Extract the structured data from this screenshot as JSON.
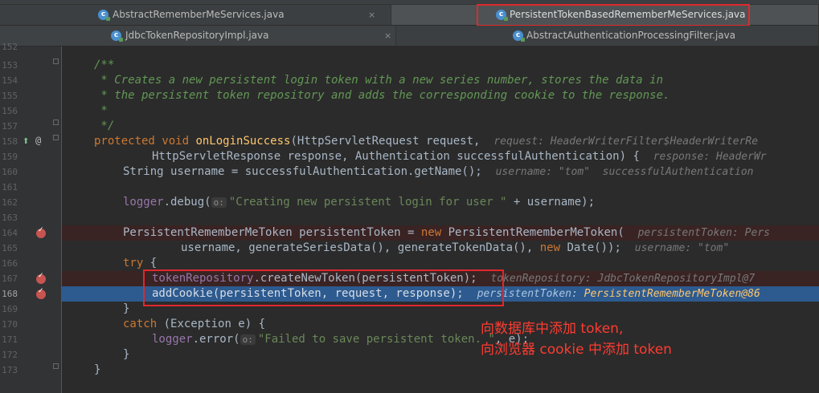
{
  "tabs_row1": [
    {
      "label": "AbstractRememberMeServices.java",
      "close": "×",
      "active": false
    },
    {
      "label": "PersistentTokenBasedRememberMeServices.java",
      "active": true
    }
  ],
  "tabs_row2": [
    {
      "label": "JdbcTokenRepositoryImpl.java",
      "close": "×"
    },
    {
      "label": "AbstractAuthenticationProcessingFilter.java"
    }
  ],
  "line_numbers": [
    "152",
    "153",
    "154",
    "155",
    "156",
    "157",
    "158",
    "159",
    "160",
    "161",
    "162",
    "163",
    "164",
    "165",
    "166",
    "167",
    "168",
    "169",
    "170",
    "171",
    "172",
    "173"
  ],
  "code": {
    "l153": "/**",
    "l154": " * Creates a new persistent login token with a new series number, stores the data in",
    "l155": " * the persistent token repository and adds the corresponding cookie to the response.",
    "l156": " *",
    "l157": " */",
    "l158_kw1": "protected",
    "l158_kw2": "void",
    "l158_fn": "onLoginSuccess",
    "l158_rest": "(HttpServletRequest request,",
    "l158_hint": "request: HeaderWriterFilter$HeaderWriterRe",
    "l159": "HttpServletResponse response, Authentication successfulAuthentication) {",
    "l159_hint": "response: HeaderWr",
    "l160": "String username = successfulAuthentication.getName();",
    "l160_hint": "username: \"tom\"  successfulAuthentication",
    "l162_fld": "logger",
    "l162_a": ".debug(",
    "l162_o": "o:",
    "l162_str": "\"Creating new persistent login for user \"",
    "l162_b": " + username);",
    "l164_a": "PersistentRememberMeToken persistentToken = ",
    "l164_kw": "new",
    "l164_b": " PersistentRememberMeToken(",
    "l164_hint": "persistentToken: Pers",
    "l165_a": "username, generateSeriesData(), generateTokenData(), ",
    "l165_kw": "new",
    "l165_b": " Date());",
    "l165_hint": "username: \"tom\"",
    "l166_kw": "try",
    "l166_b": " {",
    "l167_fld": "tokenRepository",
    "l167_b": ".createNewToken(persistentToken);",
    "l167_hint": "tokenRepository: JdbcTokenRepositoryImpl@7",
    "l168": "addCookie(persistentToken, request, response);",
    "l168_hint_k": "persistentToken: ",
    "l168_hint_v": "PersistentRememberMeToken@86",
    "l169": "}",
    "l170_kw": "catch",
    "l170_b": " (Exception e) {",
    "l171_fld": "logger",
    "l171_a": ".error(",
    "l171_o": "o:",
    "l171_str": "\"Failed to save persistent token. \"",
    "l171_b": ", e);",
    "l172": "}",
    "l173": "}"
  },
  "gutter_marks": {
    "implements": "⬆",
    "override": "@"
  },
  "annotation": {
    "line1": "向数据库中添加 token,",
    "line2": "向浏览器 cookie 中添加 token"
  },
  "colors": {
    "highlight_border": "#e0282c",
    "annotation_text": "#ff3b30",
    "exec_line": "#2d5a8f",
    "breakpoint": "#c75450"
  }
}
